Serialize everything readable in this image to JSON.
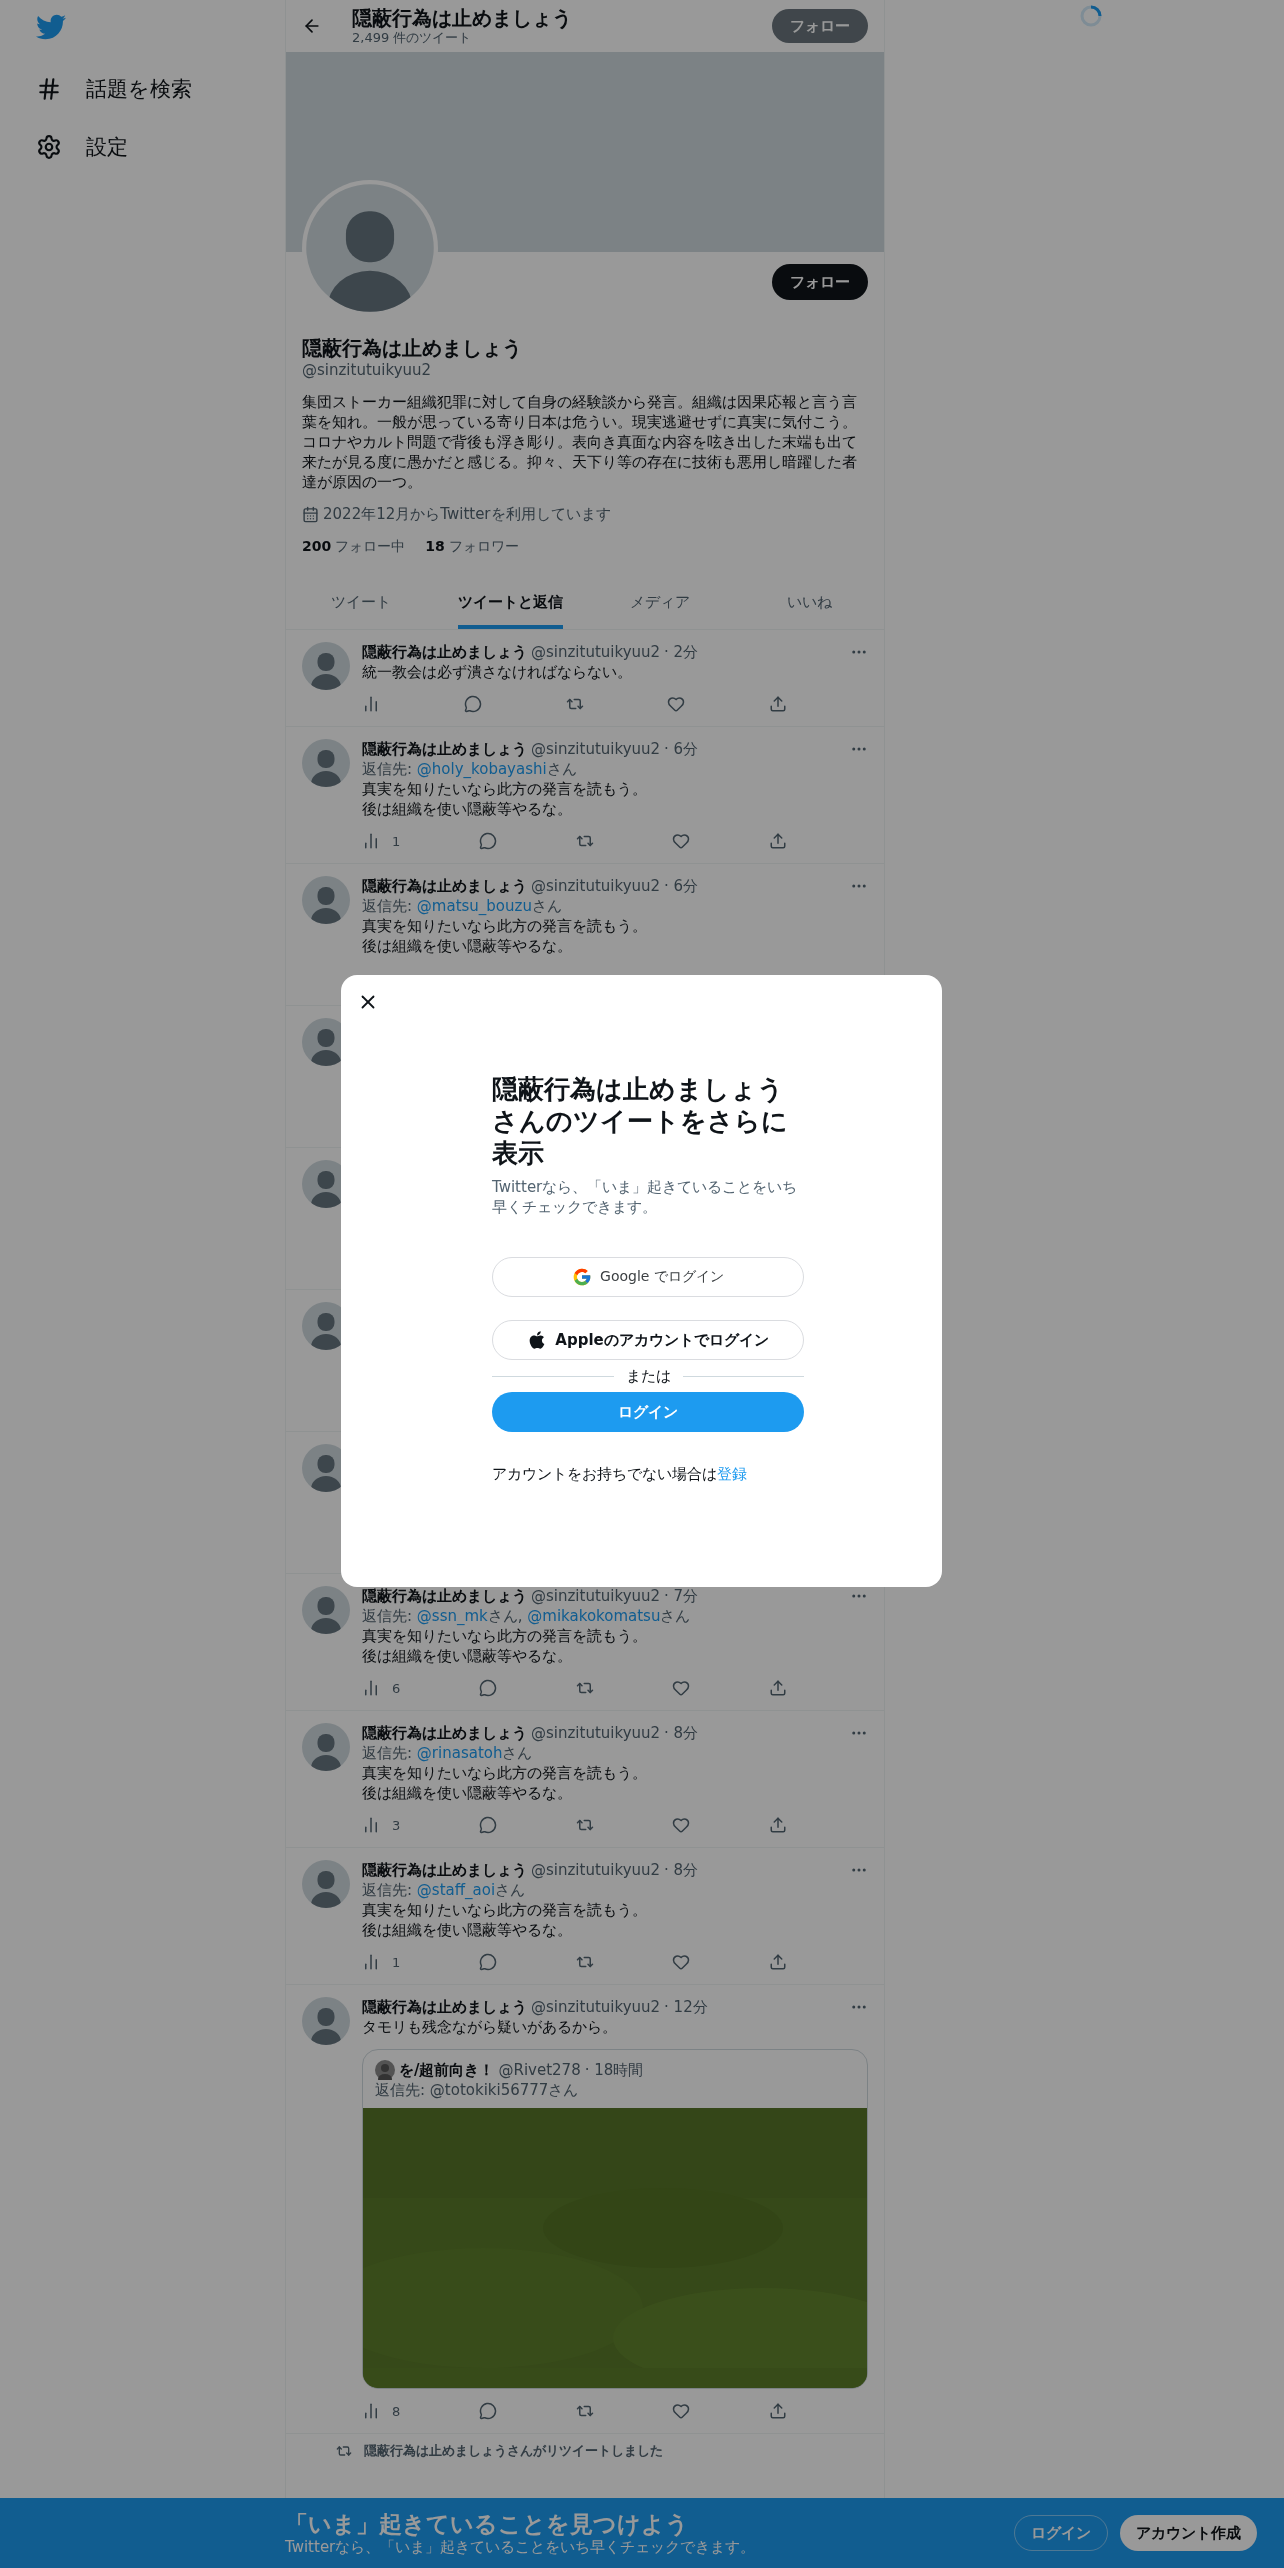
{
  "sidebar": {
    "items": [
      {
        "kind": "hash",
        "label": "話題を検索"
      },
      {
        "kind": "gear",
        "label": "設定"
      }
    ]
  },
  "header": {
    "title": "隠蔽行為は止めましょう",
    "subtitle": "2,499 件のツイート",
    "follow": "フォロー"
  },
  "profile": {
    "follow": "フォロー",
    "name": "隠蔽行為は止めましょう",
    "handle": "@sinzitutuikyuu2",
    "bio": "集団ストーカー組織犯罪に対して自身の経験談から発言。組織は因果応報と言う言葉を知れ。一般が思っている寄り日本は危うい。現実逃避せずに真実に気付こう。コロナやカルト問題で背後も浮き彫り。表向き真面な内容を呟き出した末端も出て来たが見る度に愚かだと感じる。抑々、天下り等の存在に技術も悪用し暗躍した者達が原因の一つ。",
    "joined": "2022年12月からTwitterを利用しています",
    "stats": [
      {
        "count": "200",
        "label": "フォロー中"
      },
      {
        "count": "18",
        "label": "フォロワー"
      }
    ]
  },
  "tabs": [
    {
      "label": "ツイート",
      "selected": false
    },
    {
      "label": "ツイートと返信",
      "selected": true
    },
    {
      "label": "メディア",
      "selected": false
    },
    {
      "label": "いいね",
      "selected": false
    }
  ],
  "tweets": [
    {
      "kind": "full",
      "name": "隠蔽行為は止めましょう",
      "handle": "@sinzitutuikyuu2",
      "time": "· 2分",
      "text": [
        "統一教会は必ず潰さなければならない。"
      ]
    },
    {
      "kind": "full",
      "name": "隠蔽行為は止めましょう",
      "handle": "@sinzitutuikyuu2",
      "time": "· 6分",
      "reply": {
        "label": "返信先:",
        "targets": [
          {
            "handle": "@holy_kobayashi",
            "suffix": "さん"
          }
        ]
      },
      "text": [
        "真実を知りたいなら此方の発言を読もう。",
        "後は組織を使い隠蔽等やるな。"
      ],
      "views": "1"
    },
    {
      "kind": "actions_covered",
      "name": "隠蔽行為は止めましょう",
      "handle": "@sinzitutuikyuu2",
      "time": "· 6分",
      "reply": {
        "label": "返信先:",
        "targets": [
          {
            "handle": "@matsu_bouzu",
            "suffix": "さん"
          }
        ]
      },
      "text": [
        "真実を知りたいなら此方の発言を読もう。",
        "後は組織を使い隠蔽等やるな。"
      ]
    },
    {
      "kind": "covered"
    },
    {
      "kind": "covered"
    },
    {
      "kind": "covered"
    },
    {
      "kind": "covered"
    },
    {
      "kind": "full",
      "name": "隠蔽行為は止めましょう",
      "handle": "@sinzitutuikyuu2",
      "time": "· 7分",
      "reply": {
        "label": "返信先:",
        "targets": [
          {
            "handle": "@ssn_mk",
            "suffix": "さん,"
          },
          {
            "handle": "@mikakokomatsu",
            "suffix": "さん"
          }
        ]
      },
      "text": [
        "真実を知りたいなら此方の発言を読もう。",
        "後は組織を使い隠蔽等やるな。"
      ],
      "views": "6"
    },
    {
      "kind": "full",
      "name": "隠蔽行為は止めましょう",
      "handle": "@sinzitutuikyuu2",
      "time": "· 8分",
      "reply": {
        "label": "返信先:",
        "targets": [
          {
            "handle": "@rinasatoh",
            "suffix": "さん"
          }
        ]
      },
      "text": [
        "真実を知りたいなら此方の発言を読もう。",
        "後は組織を使い隠蔽等やるな。"
      ],
      "views": "3"
    },
    {
      "kind": "full",
      "name": "隠蔽行為は止めましょう",
      "handle": "@sinzitutuikyuu2",
      "time": "· 8分",
      "reply": {
        "label": "返信先:",
        "targets": [
          {
            "handle": "@staff_aoi",
            "suffix": "さん"
          }
        ]
      },
      "text": [
        "真実を知りたいなら此方の発言を読もう。",
        "後は組織を使い隠蔽等やるな。"
      ],
      "views": "1"
    },
    {
      "kind": "full",
      "name": "隠蔽行為は止めましょう",
      "handle": "@sinzitutuikyuu2",
      "time": "· 12分",
      "text": [
        "タモリも残念ながら疑いがあるから。"
      ],
      "quote": {
        "name": "を/超前向き！",
        "handle": "@Rivet278",
        "time": "· 18時間",
        "reply": "返信先: @totokiki56777さん"
      },
      "views": "8"
    }
  ],
  "retweet_note": "隠蔽行為は止めましょうさんがリツイートしました",
  "modal": {
    "title": "隠蔽行為は止めましょうさんのツイートをさらに表示",
    "subtitle": "Twitterなら、「いま」起きていることをいち早くチェックできます。",
    "google": "Google でログイン",
    "apple": "Appleのアカウントでログイン",
    "divider": "または",
    "login": "ログイン",
    "signup_prompt": "アカウントをお持ちでない場合は",
    "signup_link": "登録"
  },
  "bottom_bar": {
    "title": "「いま」起きていることを見つけよう",
    "subtitle": "Twitterなら、「いま」起きていることをいち早くチェックできます。",
    "login": "ログイン",
    "signup": "アカウント作成"
  }
}
